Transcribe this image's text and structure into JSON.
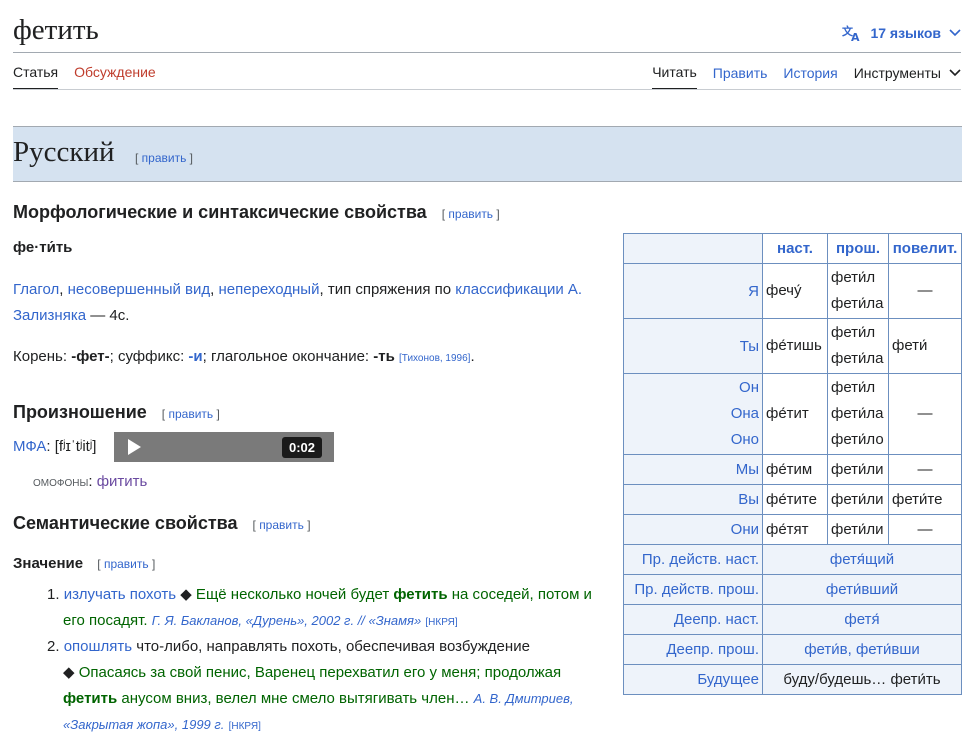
{
  "header": {
    "title": "фетить",
    "languages_label": "17 языков",
    "tabs_left": [
      "Статья",
      "Обсуждение"
    ],
    "tabs_right": [
      "Читать",
      "Править",
      "История",
      "Инструменты"
    ]
  },
  "section": {
    "language": "Русский",
    "edit_label": "править",
    "h_morph": "Морфологические и синтаксические свойства",
    "h_pron": "Произношение",
    "h_sem": "Семантические свойства",
    "h_meaning": "Значение"
  },
  "morph": {
    "syllables": "фе·ти́ть",
    "link_verb": "Глагол",
    "link_aspect": "несовершенный вид",
    "link_trans": "непереходный",
    "text_conj": ", тип спряжения по ",
    "link_class": "классификации А. Зализняка",
    "text_class": " — 4c.",
    "root_label": "Корень: ",
    "root": "-фет-",
    "suffix_label": "; суффикс: ",
    "suffix": "-и",
    "ending_label": "; глагольное окончание: ",
    "ending": "-ть",
    "ref": "[Тихонов, 1996]",
    "dot": "."
  },
  "pron": {
    "ipa_label": "МФА",
    "ipa": ": [fʲɪˈtʲitʲ]",
    "time": "0:02",
    "homophones_label": "омофоны",
    "homophone": "фитить"
  },
  "meanings": [
    {
      "num": "1.",
      "term": "излучать похоть",
      "bullet": "◆",
      "example_pre": " Ещё несколько ночей будет ",
      "example_bold": "фетить",
      "example_post": " на соседей, потом и его посадят.",
      "cite": "Г. Я. Бакланов, «Дурень», 2002 г. // «Знамя»",
      "cite_ref": "[НКРЯ]"
    },
    {
      "num": "2.",
      "term": "опошлять",
      "def": " что-либо, направлять похоть, обеспечивая возбуждение",
      "bullet": "◆",
      "example_pre": " Опасаясь за свой пенис, Варенец перехватил его у меня; продолжая ",
      "example_bold": "фетить",
      "example_post": " анусом вниз, велел мне смело вытягивать член…",
      "cite": "А. В. Дмитриев, «Закрытая жопа», 1999 г.",
      "cite_ref": "[НКРЯ]"
    }
  ],
  "conjugation": {
    "headers": [
      "наст.",
      "прош.",
      "повелит."
    ],
    "rows": [
      {
        "pron": [
          "Я"
        ],
        "pres": "фечу́",
        "past": [
          "фети́л",
          "фети́ла"
        ],
        "imp": "—"
      },
      {
        "pron": [
          "Ты"
        ],
        "pres": "фе́тишь",
        "past": [
          "фети́л",
          "фети́ла"
        ],
        "imp": "фети́"
      },
      {
        "pron": [
          "Он",
          "Она",
          "Оно"
        ],
        "pres": "фе́тит",
        "past": [
          "фети́л",
          "фети́ла",
          "фети́ло"
        ],
        "imp": "—"
      },
      {
        "pron": [
          "Мы"
        ],
        "pres": "фе́тим",
        "past": [
          "фети́ли"
        ],
        "imp": "—"
      },
      {
        "pron": [
          "Вы"
        ],
        "pres": "фе́тите",
        "past": [
          "фети́ли"
        ],
        "imp": "фети́те"
      },
      {
        "pron": [
          "Они"
        ],
        "pres": "фе́тят",
        "past": [
          "фети́ли"
        ],
        "imp": "—"
      }
    ],
    "footer": [
      {
        "label": "Пр. действ. наст.",
        "value": "фетя́щий"
      },
      {
        "label": "Пр. действ. прош.",
        "value": "фети́вший"
      },
      {
        "label": "Деепр. наст.",
        "value": "фетя́"
      },
      {
        "label": "Деепр. прош.",
        "value": "фети́в, фети́вши"
      },
      {
        "label": "Будущее",
        "value": "буду/будешь… фети́ть"
      }
    ]
  }
}
